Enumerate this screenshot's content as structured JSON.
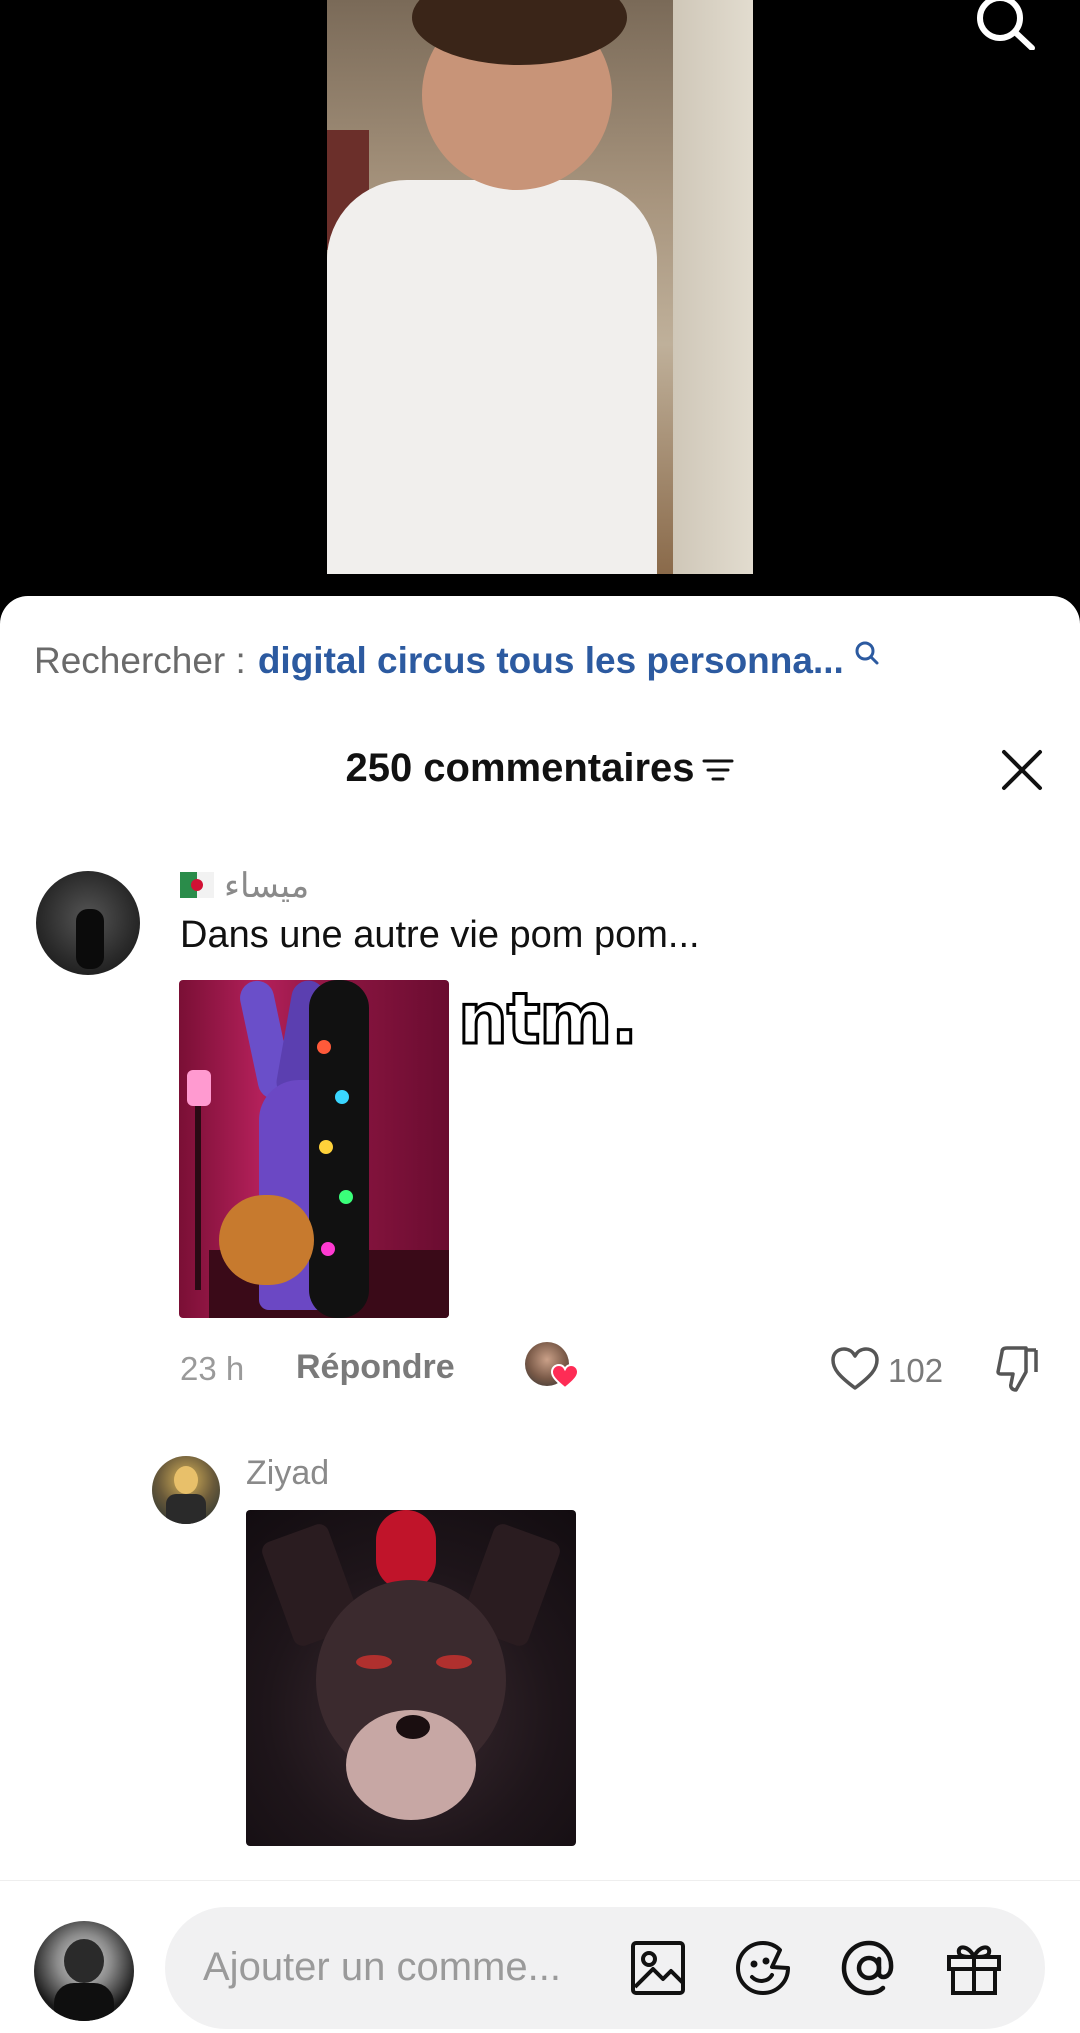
{
  "search": {
    "prefix": "Rechercher :",
    "query": "digital circus tous les personna..."
  },
  "comments": {
    "count_label": "250 commentaires"
  },
  "comment1": {
    "author": "ميساء",
    "text": "Dans une autre vie pom pom...",
    "gif_caption": "ntm.",
    "time": "23 h",
    "reply_label": "Répondre",
    "likes": "102"
  },
  "reply1": {
    "author": "Ziyad"
  },
  "composer": {
    "placeholder": "Ajouter un comme..."
  },
  "colors": {
    "link_blue": "#2c5aa0",
    "heart_red": "#fe2c55"
  },
  "icons": [
    "search-icon",
    "filter-icon",
    "close-icon",
    "heart-icon",
    "dislike-icon",
    "image-icon",
    "emoji-icon",
    "mention-icon",
    "gift-icon"
  ]
}
